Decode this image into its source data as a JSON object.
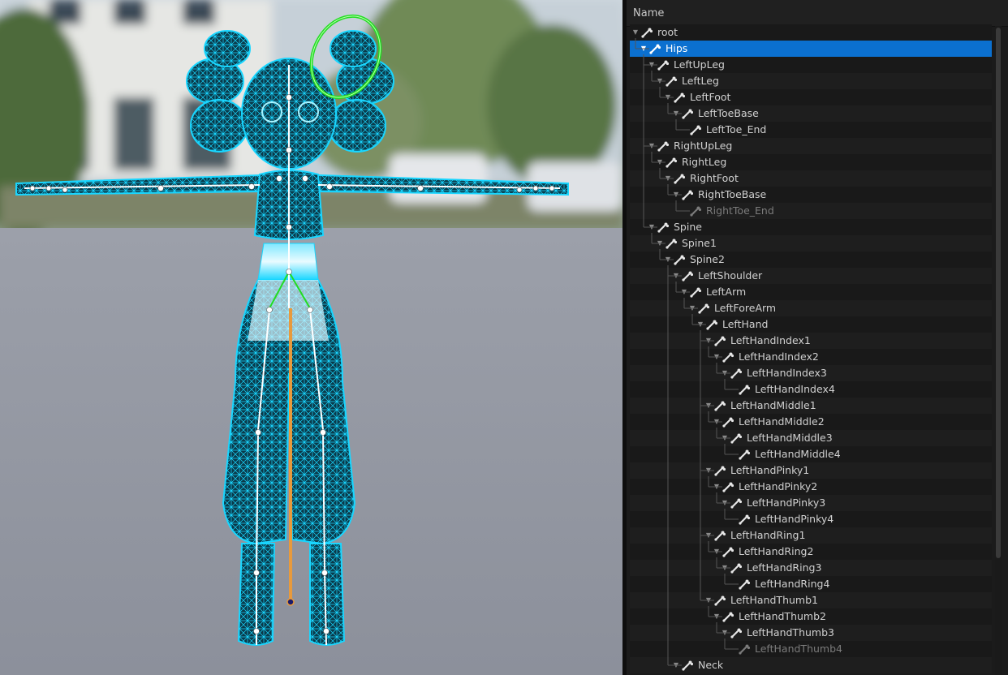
{
  "panel": {
    "header": "Name",
    "bones": [
      {
        "name": "root",
        "depth": 0,
        "expanded": true,
        "selected": false,
        "faded": false
      },
      {
        "name": "Hips",
        "depth": 1,
        "expanded": true,
        "selected": true,
        "faded": false
      },
      {
        "name": "LeftUpLeg",
        "depth": 2,
        "expanded": true,
        "selected": false,
        "faded": false
      },
      {
        "name": "LeftLeg",
        "depth": 3,
        "expanded": true,
        "selected": false,
        "faded": false
      },
      {
        "name": "LeftFoot",
        "depth": 4,
        "expanded": true,
        "selected": false,
        "faded": false
      },
      {
        "name": "LeftToeBase",
        "depth": 5,
        "expanded": true,
        "selected": false,
        "faded": false
      },
      {
        "name": "LeftToe_End",
        "depth": 6,
        "expanded": false,
        "selected": false,
        "faded": false
      },
      {
        "name": "RightUpLeg",
        "depth": 2,
        "expanded": true,
        "selected": false,
        "faded": false
      },
      {
        "name": "RightLeg",
        "depth": 3,
        "expanded": true,
        "selected": false,
        "faded": false
      },
      {
        "name": "RightFoot",
        "depth": 4,
        "expanded": true,
        "selected": false,
        "faded": false
      },
      {
        "name": "RightToeBase",
        "depth": 5,
        "expanded": true,
        "selected": false,
        "faded": false
      },
      {
        "name": "RightToe_End",
        "depth": 6,
        "expanded": false,
        "selected": false,
        "faded": true
      },
      {
        "name": "Spine",
        "depth": 2,
        "expanded": true,
        "selected": false,
        "faded": false
      },
      {
        "name": "Spine1",
        "depth": 3,
        "expanded": true,
        "selected": false,
        "faded": false
      },
      {
        "name": "Spine2",
        "depth": 4,
        "expanded": true,
        "selected": false,
        "faded": false
      },
      {
        "name": "LeftShoulder",
        "depth": 5,
        "expanded": true,
        "selected": false,
        "faded": false
      },
      {
        "name": "LeftArm",
        "depth": 6,
        "expanded": true,
        "selected": false,
        "faded": false
      },
      {
        "name": "LeftForeArm",
        "depth": 7,
        "expanded": true,
        "selected": false,
        "faded": false
      },
      {
        "name": "LeftHand",
        "depth": 8,
        "expanded": true,
        "selected": false,
        "faded": false
      },
      {
        "name": "LeftHandIndex1",
        "depth": 9,
        "expanded": true,
        "selected": false,
        "faded": false
      },
      {
        "name": "LeftHandIndex2",
        "depth": 10,
        "expanded": true,
        "selected": false,
        "faded": false
      },
      {
        "name": "LeftHandIndex3",
        "depth": 11,
        "expanded": true,
        "selected": false,
        "faded": false
      },
      {
        "name": "LeftHandIndex4",
        "depth": 12,
        "expanded": false,
        "selected": false,
        "faded": false
      },
      {
        "name": "LeftHandMiddle1",
        "depth": 9,
        "expanded": true,
        "selected": false,
        "faded": false
      },
      {
        "name": "LeftHandMiddle2",
        "depth": 10,
        "expanded": true,
        "selected": false,
        "faded": false
      },
      {
        "name": "LeftHandMiddle3",
        "depth": 11,
        "expanded": true,
        "selected": false,
        "faded": false
      },
      {
        "name": "LeftHandMiddle4",
        "depth": 12,
        "expanded": false,
        "selected": false,
        "faded": false
      },
      {
        "name": "LeftHandPinky1",
        "depth": 9,
        "expanded": true,
        "selected": false,
        "faded": false
      },
      {
        "name": "LeftHandPinky2",
        "depth": 10,
        "expanded": true,
        "selected": false,
        "faded": false
      },
      {
        "name": "LeftHandPinky3",
        "depth": 11,
        "expanded": true,
        "selected": false,
        "faded": false
      },
      {
        "name": "LeftHandPinky4",
        "depth": 12,
        "expanded": false,
        "selected": false,
        "faded": false
      },
      {
        "name": "LeftHandRing1",
        "depth": 9,
        "expanded": true,
        "selected": false,
        "faded": false
      },
      {
        "name": "LeftHandRing2",
        "depth": 10,
        "expanded": true,
        "selected": false,
        "faded": false
      },
      {
        "name": "LeftHandRing3",
        "depth": 11,
        "expanded": true,
        "selected": false,
        "faded": false
      },
      {
        "name": "LeftHandRing4",
        "depth": 12,
        "expanded": false,
        "selected": false,
        "faded": false
      },
      {
        "name": "LeftHandThumb1",
        "depth": 9,
        "expanded": true,
        "selected": false,
        "faded": false
      },
      {
        "name": "LeftHandThumb2",
        "depth": 10,
        "expanded": true,
        "selected": false,
        "faded": false
      },
      {
        "name": "LeftHandThumb3",
        "depth": 11,
        "expanded": true,
        "selected": false,
        "faded": false
      },
      {
        "name": "LeftHandThumb4",
        "depth": 12,
        "expanded": false,
        "selected": false,
        "faded": true
      },
      {
        "name": "Neck",
        "depth": 5,
        "expanded": true,
        "selected": false,
        "faded": false
      }
    ]
  },
  "colors": {
    "selection": "#0b70d0",
    "mesh_wire": "#19d6ff",
    "bone": "#ffffff",
    "rotation_gizmo": "#22dd22",
    "root_bone": "#e89a3c"
  }
}
